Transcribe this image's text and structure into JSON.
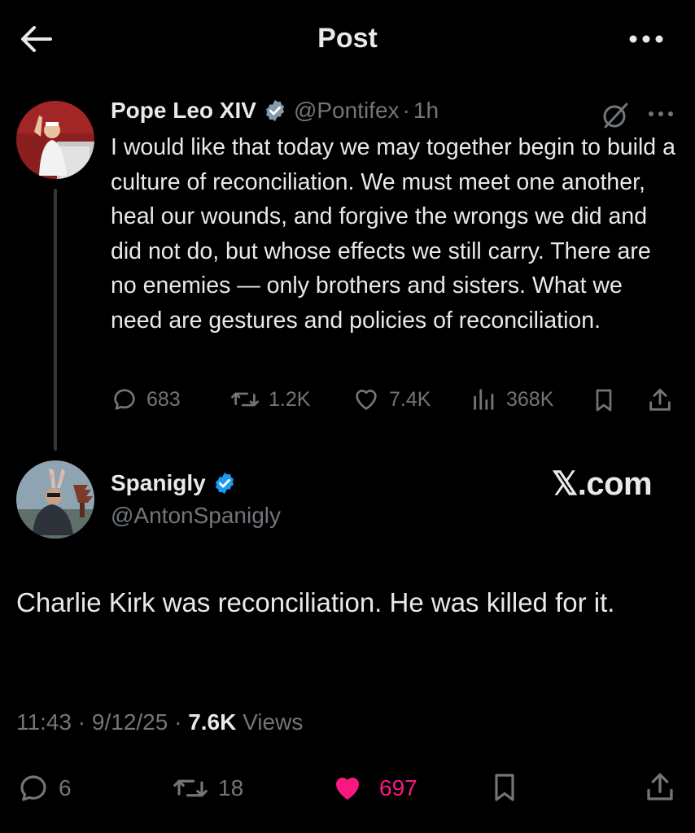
{
  "header": {
    "title": "Post"
  },
  "quoted_tweet": {
    "author_name": "Pope Leo XIV",
    "handle": "@Pontifex",
    "separator": "·",
    "time": "1h",
    "text": "I would like that today we may together begin to build a culture of reconciliation. We must meet one another, heal our wounds, and forgive the wrongs we did and did not do, but whose effects we still carry. There are no enemies — only brothers and sisters. What we need are gestures and policies of reconciliation.",
    "replies": "683",
    "reposts": "1.2K",
    "likes": "7.4K",
    "views": "368K"
  },
  "main_tweet": {
    "author_name": "Spanigly",
    "handle": "@AntonSpanigly",
    "watermark": "𝕏.com",
    "text": "Charlie Kirk was reconciliation. He was killed for it.",
    "time": "11:43",
    "date": "9/12/25",
    "dot": "·",
    "views_count": "7.6K",
    "views_label": "Views",
    "replies": "6",
    "reposts": "18",
    "likes": "697"
  },
  "colors": {
    "background": "#000000",
    "text": "#e7e9ea",
    "muted": "#71767b",
    "verified": "#1d9bf0",
    "like": "#f91880"
  },
  "icons": [
    "back-arrow-icon",
    "more-icon",
    "verified-icon",
    "grok-icon",
    "reply-icon",
    "repost-icon",
    "like-icon",
    "views-icon",
    "bookmark-icon",
    "share-icon"
  ]
}
